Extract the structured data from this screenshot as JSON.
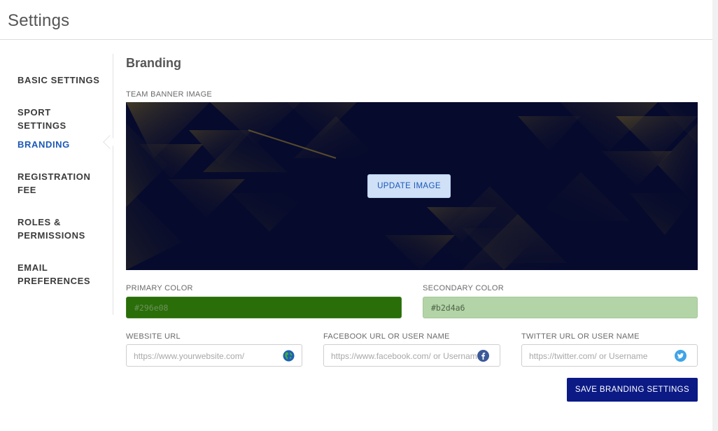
{
  "page": {
    "title": "Settings"
  },
  "sidebar": {
    "items": [
      {
        "label": "BASIC SETTINGS"
      },
      {
        "label": "SPORT SETTINGS"
      },
      {
        "label": "BRANDING"
      },
      {
        "label": "REGISTRATION FEE"
      },
      {
        "label": "ROLES & PERMISSIONS"
      },
      {
        "label": "EMAIL PREFERENCES"
      }
    ],
    "active": "BRANDING"
  },
  "branding": {
    "title": "Branding",
    "banner": {
      "label": "TEAM BANNER IMAGE",
      "update_label": "UPDATE IMAGE"
    },
    "primary_color": {
      "label": "PRIMARY COLOR",
      "value": "#296e08"
    },
    "secondary_color": {
      "label": "SECONDARY COLOR",
      "value": "#b2d4a6"
    },
    "website": {
      "label": "WEBSITE URL",
      "placeholder": "https://www.yourwebsite.com/",
      "icon": "globe-icon"
    },
    "facebook": {
      "label": "FACEBOOK URL OR USER NAME",
      "placeholder": "https://www.facebook.com/ or Username",
      "icon": "facebook-icon"
    },
    "twitter": {
      "label": "TWITTER URL OR USER NAME",
      "placeholder": "https://twitter.com/ or Username",
      "icon": "twitter-icon"
    },
    "save_label": "SAVE BRANDING SETTINGS"
  },
  "colors": {
    "accent": "#1c58b8",
    "save_button": "#0b1a85",
    "banner_bg": "#060a2c"
  }
}
